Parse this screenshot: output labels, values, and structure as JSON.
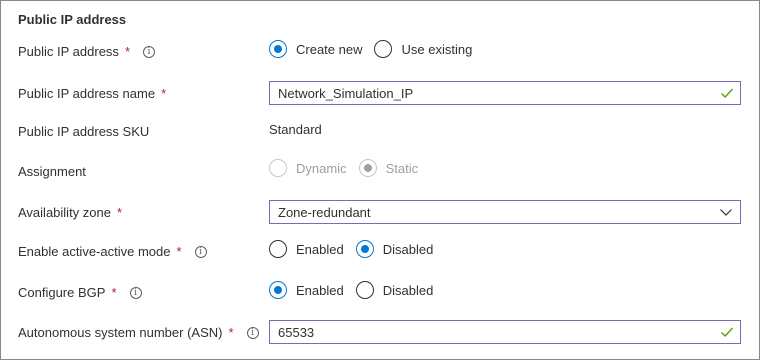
{
  "section": {
    "title": "Public IP address"
  },
  "public_ip": {
    "label": "Public IP address",
    "required": "*",
    "options": [
      "Create new",
      "Use existing"
    ],
    "selected": "Create new"
  },
  "public_ip_name": {
    "label": "Public IP address name",
    "required": "*",
    "value": "Network_Simulation_IP"
  },
  "sku": {
    "label": "Public IP address SKU",
    "value": "Standard"
  },
  "assignment": {
    "label": "Assignment",
    "options": [
      "Dynamic",
      "Static"
    ],
    "selected": "Static"
  },
  "availability_zone": {
    "label": "Availability zone",
    "required": "*",
    "value": "Zone-redundant"
  },
  "active_active": {
    "label": "Enable active-active mode",
    "required": "*",
    "options": [
      "Enabled",
      "Disabled"
    ],
    "selected": "Disabled"
  },
  "bgp": {
    "label": "Configure BGP",
    "required": "*",
    "options": [
      "Enabled",
      "Disabled"
    ],
    "selected": "Enabled"
  },
  "asn": {
    "label": "Autonomous system number (ASN)",
    "required": "*",
    "value": "65533"
  },
  "colors": {
    "accent": "#0078d4",
    "field_border": "#8764b8",
    "valid_check": "#57a300",
    "required": "#a4262c"
  }
}
